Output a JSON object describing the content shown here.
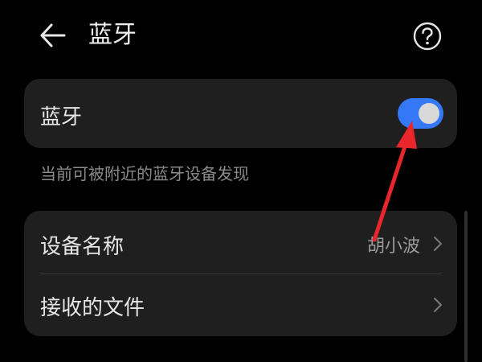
{
  "header": {
    "title": "蓝牙",
    "back_icon": "arrow-left-icon",
    "help_icon": "question-circle-icon"
  },
  "bluetooth_card": {
    "label": "蓝牙",
    "toggle_on": true,
    "toggle_color": "#3478f6"
  },
  "visibility_hint": "当前可被附近的蓝牙设备发现",
  "device_card": {
    "rows": [
      {
        "label": "设备名称",
        "value": "胡小波",
        "icon": "chevron-right-icon"
      },
      {
        "label": "接收的文件",
        "value": "",
        "icon": "chevron-right-icon"
      }
    ]
  },
  "colors": {
    "background": "#000000",
    "card": "#1f1f1f",
    "annotation_arrow": "#e8262b"
  }
}
